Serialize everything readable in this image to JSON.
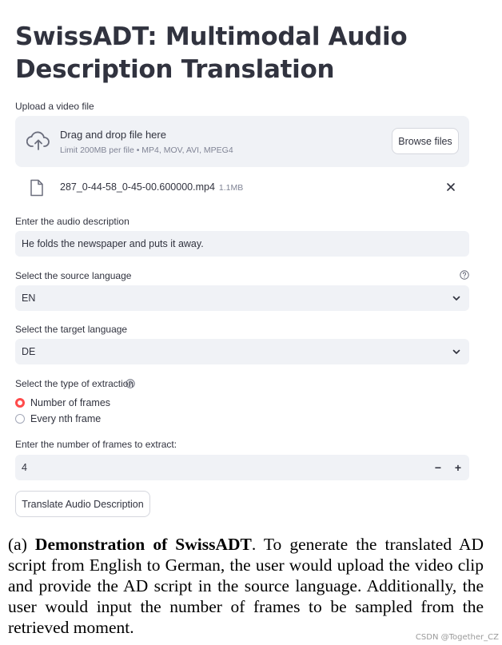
{
  "title": "SwissADT: Multimodal Audio Description Translation",
  "upload": {
    "label": "Upload a video file",
    "drag_text": "Drag and drop file here",
    "limit_text": "Limit 200MB per file • MP4, MOV, AVI, MPEG4",
    "browse_label": "Browse files",
    "file_name": "287_0-44-58_0-45-00.600000.mp4",
    "file_size": "1.1MB"
  },
  "audio_description": {
    "label": "Enter the audio description",
    "value": "He folds the newspaper and puts it away."
  },
  "source_language": {
    "label": "Select the source language",
    "value": "EN"
  },
  "target_language": {
    "label": "Select the target language",
    "value": "DE"
  },
  "extraction": {
    "label": "Select the type of extraction",
    "options": [
      {
        "label": "Number of frames",
        "selected": true
      },
      {
        "label": "Every nth frame",
        "selected": false
      }
    ]
  },
  "frames": {
    "label": "Enter the number of frames to extract:",
    "value": "4",
    "minus": "−",
    "plus": "+"
  },
  "translate_button": "Translate Audio Description",
  "caption": {
    "prefix": "(a) ",
    "bold": "Demonstration of SwissADT",
    "text": ". To generate the translated AD script from English to German, the user would upload the video clip and provide the AD script in the source language. Additionally, the user would input the number of frames to be sampled from the retrieved moment."
  },
  "watermark": "CSDN @Together_CZ",
  "colors": {
    "accent": "#ff4b4b",
    "input_bg": "#f0f2f6",
    "text": "#31333f",
    "muted": "#808495"
  }
}
